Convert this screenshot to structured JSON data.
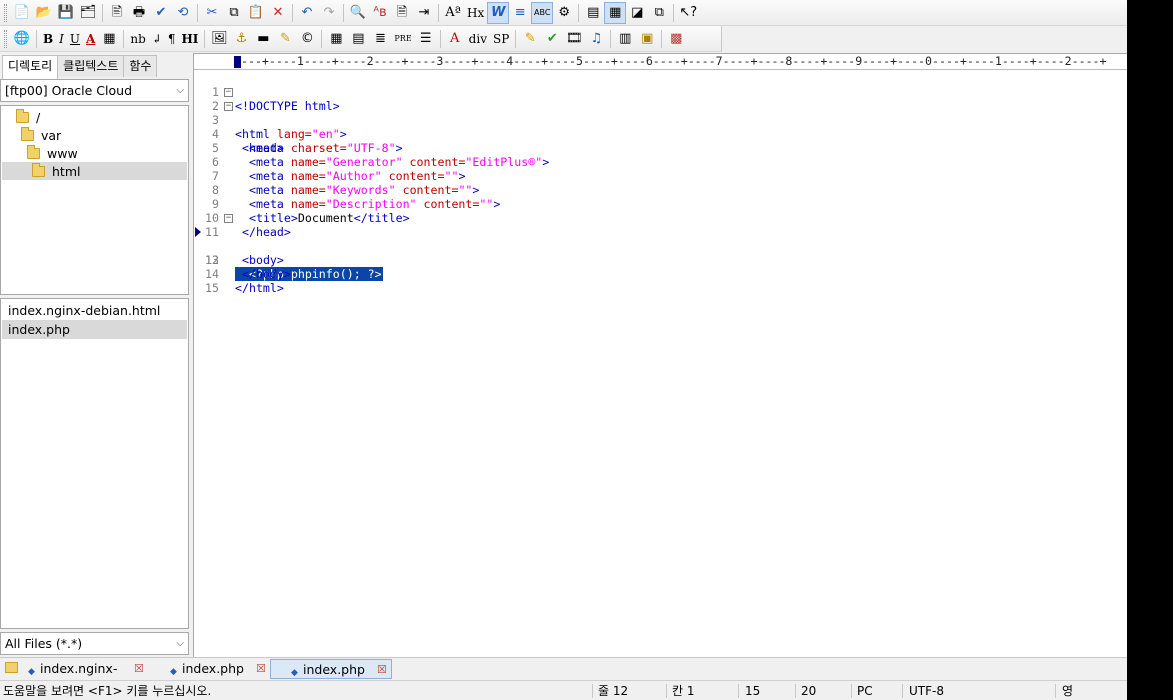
{
  "toolbar1": {
    "icons": [
      "new-file-icon",
      "open-file-icon",
      "save-icon",
      "save-all-icon",
      "print-preview-icon",
      "print-icon",
      "spellcheck-icon",
      "reload-icon",
      "cut-icon",
      "copy-icon",
      "paste-icon",
      "delete-icon",
      "undo-icon",
      "redo-icon",
      "find-icon",
      "replace-icon",
      "find-in-files-icon",
      "goto-icon",
      "font-icon",
      "hx-icon",
      "word-wrap-icon",
      "line-number-icon",
      "ruler-icon",
      "settings-icon",
      "dir-window-icon",
      "output-window-icon",
      "clip-icon",
      "browser-icon",
      "help-icon"
    ],
    "hx_label": "Hx"
  },
  "toolbar2": {
    "bold_label": "B",
    "italic_label": "I",
    "underline_label": "U",
    "font_color_label": "A",
    "nbsp_label": "nb",
    "br_label": "↲",
    "para_label": "¶",
    "hr_label": "HI",
    "pre_label": "PRE",
    "div_label": "div",
    "span_label": "SP"
  },
  "left_panel": {
    "tabs": [
      "디렉토리",
      "클립텍스트",
      "함수"
    ],
    "site_combo": "[ftp00] Oracle Cloud",
    "tree": [
      {
        "label": "/"
      },
      {
        "label": "var"
      },
      {
        "label": "www"
      },
      {
        "label": "html"
      }
    ],
    "files": [
      "index.nginx-debian.html",
      "index.php"
    ],
    "filter_combo": "All Files (*.*)"
  },
  "editor": {
    "ruler": "----+----1----+----2----+----3----+----4----+----5----+----6----+----7----+----8----+----9----+----0----+----1----+----2----+",
    "lines": [
      {
        "n": "1"
      },
      {
        "n": "2"
      },
      {
        "n": "3"
      },
      {
        "n": "4"
      },
      {
        "n": "5"
      },
      {
        "n": "6"
      },
      {
        "n": "7"
      },
      {
        "n": "8"
      },
      {
        "n": "9"
      },
      {
        "n": "10"
      },
      {
        "n": "11"
      },
      {
        "n": "12"
      },
      {
        "n": "13"
      },
      {
        "n": "14"
      },
      {
        "n": "15"
      }
    ],
    "code": {
      "l1": "<!DOCTYPE html>",
      "l2_tag": "<html ",
      "l2_attr": "lang=",
      "l2_val": "\"en\"",
      "l2_end": ">",
      "l3": "<head>",
      "l4_tag": "<meta ",
      "l4_attr": "charset=",
      "l4_val": "\"UTF-8\"",
      "l4_end": ">",
      "l5_tag": "<meta ",
      "l5_attr1": "name=",
      "l5_val1": "\"Generator\"",
      "l5_attr2": " content=",
      "l5_val2": "\"EditPlus®\"",
      "l5_end": ">",
      "l6_tag": "<meta ",
      "l6_attr1": "name=",
      "l6_val1": "\"Author\"",
      "l6_attr2": " content=",
      "l6_val2": "\"\"",
      "l6_end": ">",
      "l7_tag": "<meta ",
      "l7_attr1": "name=",
      "l7_val1": "\"Keywords\"",
      "l7_attr2": " content=",
      "l7_val2": "\"\"",
      "l7_end": ">",
      "l8_tag": "<meta ",
      "l8_attr1": "name=",
      "l8_val1": "\"Description\"",
      "l8_attr2": " content=",
      "l8_val2": "\"\"",
      "l8_end": ">",
      "l9_open": "<title>",
      "l9_text": "Document",
      "l9_close": "</title>",
      "l10": "</head>",
      "l11": "<body>",
      "l12": "<?php phpinfo(); ?>",
      "l13": "</body>",
      "l14": "</html>"
    }
  },
  "doc_tabs": [
    {
      "label": "index.nginx-debia",
      "active": false
    },
    {
      "label": "index.php",
      "active": false
    },
    {
      "label": "index.php",
      "active": true
    }
  ],
  "status_bar": {
    "help": "도움말을 보려면 <F1> 키를 누르십시오.",
    "line": "줄 12",
    "col": "칸 1",
    "v1": "15",
    "v2": "20",
    "eol": "PC",
    "encoding": "UTF-8",
    "ime": "영"
  },
  "colors": {
    "tag": "#0000c0",
    "attr": "#c00000",
    "value": "#ff00ff",
    "selection": "#0a46a8"
  }
}
